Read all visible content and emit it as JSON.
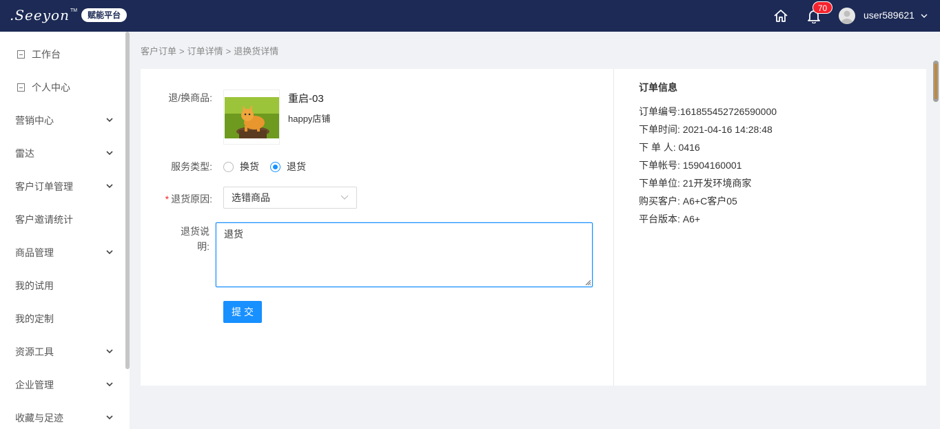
{
  "header": {
    "logo_text": ".Seeyon",
    "logo_tm": "TM",
    "platform_badge": "赋能平台",
    "notification_count": "70",
    "username": "user589621"
  },
  "sidebar": {
    "items": [
      {
        "label": "工作台",
        "icon": "page-icon",
        "expandable": false
      },
      {
        "label": "个人中心",
        "icon": "page-icon",
        "expandable": false
      },
      {
        "label": "营销中心",
        "expandable": true
      },
      {
        "label": "雷达",
        "expandable": true
      },
      {
        "label": "客户订单管理",
        "expandable": true
      },
      {
        "label": "客户邀请统计",
        "expandable": false
      },
      {
        "label": "商品管理",
        "expandable": true
      },
      {
        "label": "我的试用",
        "expandable": false
      },
      {
        "label": "我的定制",
        "expandable": false
      },
      {
        "label": "资源工具",
        "expandable": true
      },
      {
        "label": "企业管理",
        "expandable": true
      },
      {
        "label": "收藏与足迹",
        "expandable": true
      }
    ]
  },
  "breadcrumb": {
    "items": [
      "客户订单",
      "订单详情",
      "退换货详情"
    ],
    "separator": ">"
  },
  "form": {
    "product_label": "退/换商品:",
    "product_name": "重启-03",
    "shop_name": "happy店铺",
    "service_type_label": "服务类型:",
    "service_options": [
      {
        "label": "换货",
        "checked": false
      },
      {
        "label": "退货",
        "checked": true
      }
    ],
    "reason_required_mark": "*",
    "reason_label": "退货原因:",
    "reason_value": "选错商品",
    "desc_label_line1": "退货说",
    "desc_label_line2": "明:",
    "desc_value": "退货",
    "submit_label": "提交"
  },
  "order_info": {
    "title": "订单信息",
    "rows": [
      "订单编号:161855452726590000",
      "下单时间:  2021-04-16 14:28:48",
      "下 单 人:  0416",
      "下单帐号:  15904160001",
      "下单单位:  21开发环境商家",
      "购买客户:  A6+C客户05",
      "平台版本:  A6+"
    ]
  },
  "colors": {
    "header_bg": "#1c2a55",
    "primary": "#1890ff",
    "badge_red": "#f5222d"
  }
}
